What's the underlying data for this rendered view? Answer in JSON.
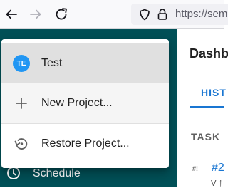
{
  "browser": {
    "url_text": "https://sem"
  },
  "app": {
    "page_title": "Dashb",
    "tab_label": "HIST",
    "column_header": "TASK",
    "row": {
      "type_badge": "#!",
      "id_text": "#2",
      "sub_text": "Ɐ †"
    },
    "sidebar_bg_color": "#005057",
    "sidebar_items": [
      {
        "label": "Schedule",
        "icon": "clock-history-icon"
      }
    ]
  },
  "project_menu": {
    "items": [
      {
        "label": "Test",
        "avatar_initials": "TE",
        "avatar_color": "#2196f3",
        "selected": true
      },
      {
        "label": "New Project...",
        "icon": "plus-icon"
      },
      {
        "label": "Restore Project...",
        "icon": "restore-icon"
      }
    ]
  }
}
